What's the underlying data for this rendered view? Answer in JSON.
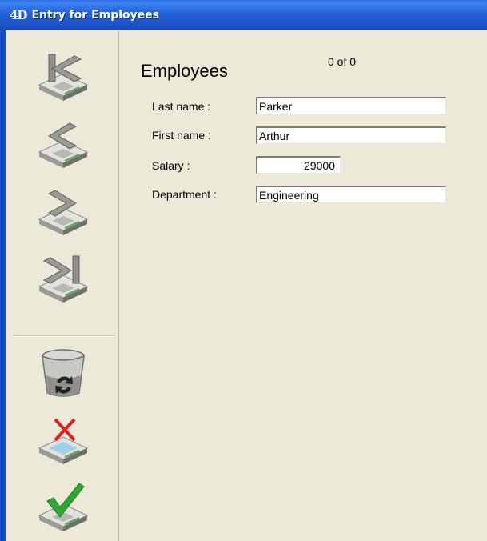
{
  "window": {
    "app_logo": "4D",
    "title": "Entry for Employees"
  },
  "toolbar": {
    "buttons": [
      {
        "name": "first-record",
        "icon": "first-record-icon"
      },
      {
        "name": "previous-record",
        "icon": "previous-record-icon"
      },
      {
        "name": "next-record",
        "icon": "next-record-icon"
      },
      {
        "name": "last-record",
        "icon": "last-record-icon"
      },
      {
        "name": "delete-record",
        "icon": "trash-icon"
      },
      {
        "name": "cancel",
        "icon": "cancel-icon"
      },
      {
        "name": "accept",
        "icon": "accept-icon"
      }
    ]
  },
  "form": {
    "table_name": "Employees",
    "record_counter": "0 of 0",
    "fields": {
      "last_name": {
        "label": "Last name :",
        "value": "Parker"
      },
      "first_name": {
        "label": "First name :",
        "value": "Arthur"
      },
      "salary": {
        "label": "Salary :",
        "value": "29000"
      },
      "department": {
        "label": "Department :",
        "value": "Engineering"
      }
    }
  },
  "colors": {
    "titlebar": "#2462d8",
    "background": "#ece9d8",
    "accept_check": "#2fa82f",
    "cancel_x": "#e0201a"
  }
}
